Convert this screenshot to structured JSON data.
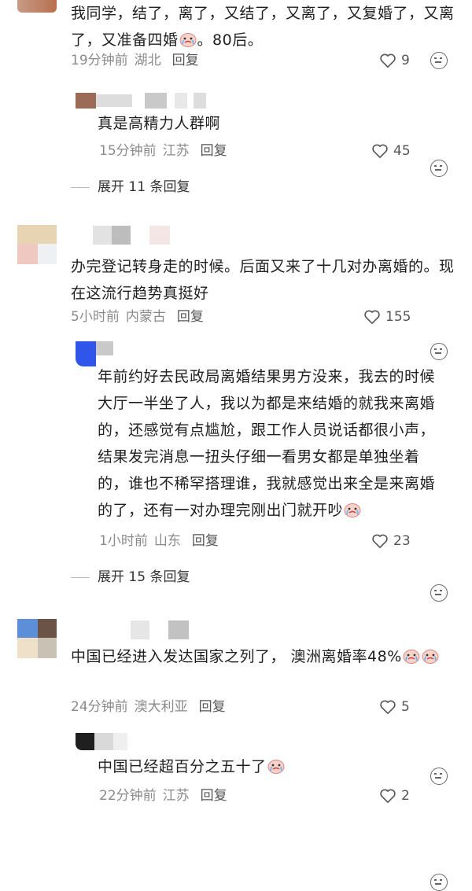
{
  "comments": [
    {
      "text": "我同学，结了，离了，又结了，又离了，又复婚了，又离了，又准备四婚😭。80后。",
      "time": "19分钟前",
      "location": "湖北",
      "reply_label": "回复",
      "likes": "9",
      "replies": [
        {
          "text": "真是高精力人群啊",
          "time": "15分钟前",
          "location": "江苏",
          "reply_label": "回复",
          "likes": "45"
        }
      ],
      "expand_label": "展开 11 条回复"
    },
    {
      "text": "办完登记转身走的时候。后面又来了十几对办离婚的。现在这流行趋势真挺好",
      "time": "5小时前",
      "location": "内蒙古",
      "reply_label": "回复",
      "likes": "155",
      "replies": [
        {
          "text": "年前约好去民政局离婚结果男方没来，我去的时候大厅一半坐了人，我以为都是来结婚的就我来离婚的，还感觉有点尴尬，跟工作人员说话都很小声，结果发完消息一扭头仔细一看男女都是单独坐着的，谁也不稀罕搭理谁，我就感觉出来全是来离婚的了，还有一对办理完刚出门就开吵😭",
          "time": "1小时前",
          "location": "山东",
          "reply_label": "回复",
          "likes": "23"
        }
      ],
      "expand_label": "展开 15 条回复"
    },
    {
      "text": "中国已经进入发达国家之列了，  澳洲离婚率48%😭😭",
      "time": "24分钟前",
      "location": "澳大利亚",
      "reply_label": "回复",
      "likes": "5",
      "replies": [
        {
          "text": "中国已经超百分之五十了😭",
          "time": "22分钟前",
          "location": "江苏",
          "reply_label": "回复",
          "likes": "2"
        }
      ]
    }
  ],
  "icons": {
    "like": "heart-outline-icon",
    "more": "emoji-face-icon",
    "emoji": "crying-face-emoji"
  },
  "colors": {
    "text": "#1f1f1f",
    "meta": "#8a8a8a",
    "background": "#ffffff"
  }
}
